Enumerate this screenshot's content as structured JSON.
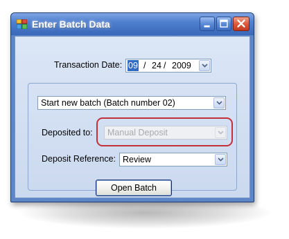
{
  "window": {
    "title": "Enter Batch Data"
  },
  "icons": {
    "app": "batch-app-icon",
    "minimize": "minimize-icon",
    "maximize": "maximize-icon",
    "close": "close-icon",
    "dropdown": "chevron-down-icon"
  },
  "form": {
    "transaction_date": {
      "label": "Transaction Date:",
      "month": "09",
      "sep1": "/",
      "day": "24",
      "sep2": "/",
      "year": "2009"
    },
    "batch": {
      "selected": "Start new batch (Batch number 02)"
    },
    "deposited_to": {
      "label": "Deposited to:",
      "value": "Manual Deposit",
      "enabled": false
    },
    "deposit_reference": {
      "label": "Deposit Reference:",
      "value": "Review"
    },
    "open_batch_button": "Open Batch"
  },
  "colors": {
    "title_bar": "#3a68b8",
    "client_background": "#d7e3f5",
    "highlight_outline": "#c2303a",
    "selected_text_bg": "#316ac5"
  }
}
